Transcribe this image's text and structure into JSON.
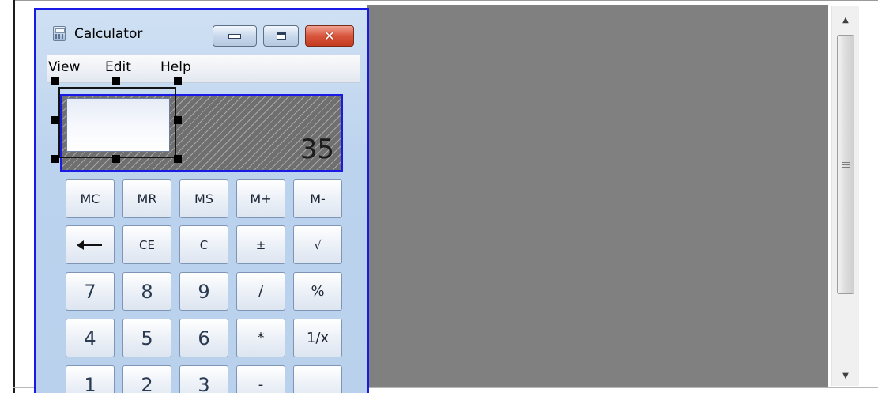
{
  "window": {
    "title": "Calculator",
    "icon": "calculator-icon",
    "controls": {
      "minimize": "minimize-icon",
      "maximize": "maximize-icon",
      "close": "✕"
    }
  },
  "menu": {
    "items": [
      "View",
      "Edit",
      "Help"
    ]
  },
  "display": {
    "value": "35"
  },
  "keys": {
    "memory": [
      "MC",
      "MR",
      "MS",
      "M+",
      "M-"
    ],
    "row2": [
      "←",
      "CE",
      "C",
      "±",
      "√"
    ],
    "row3": [
      "7",
      "8",
      "9",
      "/",
      "%"
    ],
    "row4": [
      "4",
      "5",
      "6",
      "*",
      "1/x"
    ],
    "row5": [
      "1",
      "2",
      "3",
      "-",
      ""
    ]
  },
  "scrollbar": {
    "up": "▲",
    "down": "▼"
  },
  "colors": {
    "selection_border": "#1a1ae6",
    "background_gray": "#808080",
    "window_frame": "#b9d1ec"
  }
}
